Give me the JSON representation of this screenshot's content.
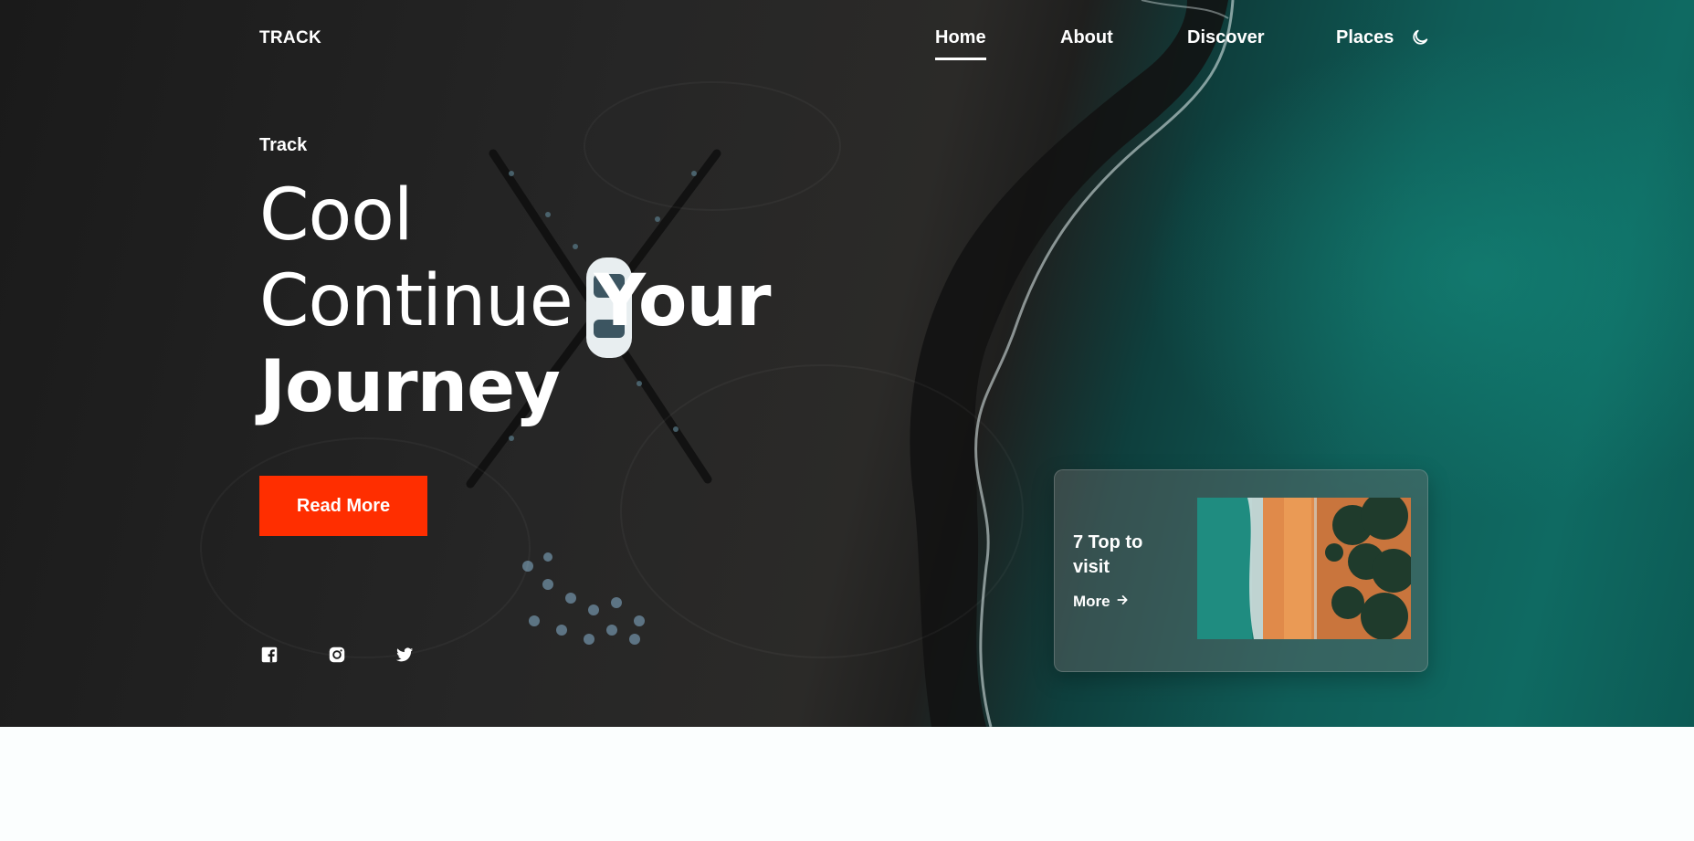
{
  "nav": {
    "logo": "TRACK",
    "links": [
      {
        "label": "Home",
        "active": true
      },
      {
        "label": "About",
        "active": false
      },
      {
        "label": "Discover",
        "active": false
      },
      {
        "label": "Places",
        "active": false
      }
    ],
    "theme_icon": "moon-icon"
  },
  "hero": {
    "subtitle": "Track",
    "headline_line1": "Cool",
    "headline_line2_light": "Continue ",
    "headline_line2_bold": "Your",
    "headline_line3_bold": "Journey",
    "cta_label": "Read More",
    "accent_color": "#ff2e00"
  },
  "socials": [
    {
      "icon": "facebook-icon"
    },
    {
      "icon": "instagram-icon"
    },
    {
      "icon": "twitter-icon"
    }
  ],
  "place_card": {
    "title": "7 Top to visit",
    "more_label": "More",
    "more_icon": "arrow-right-icon"
  }
}
